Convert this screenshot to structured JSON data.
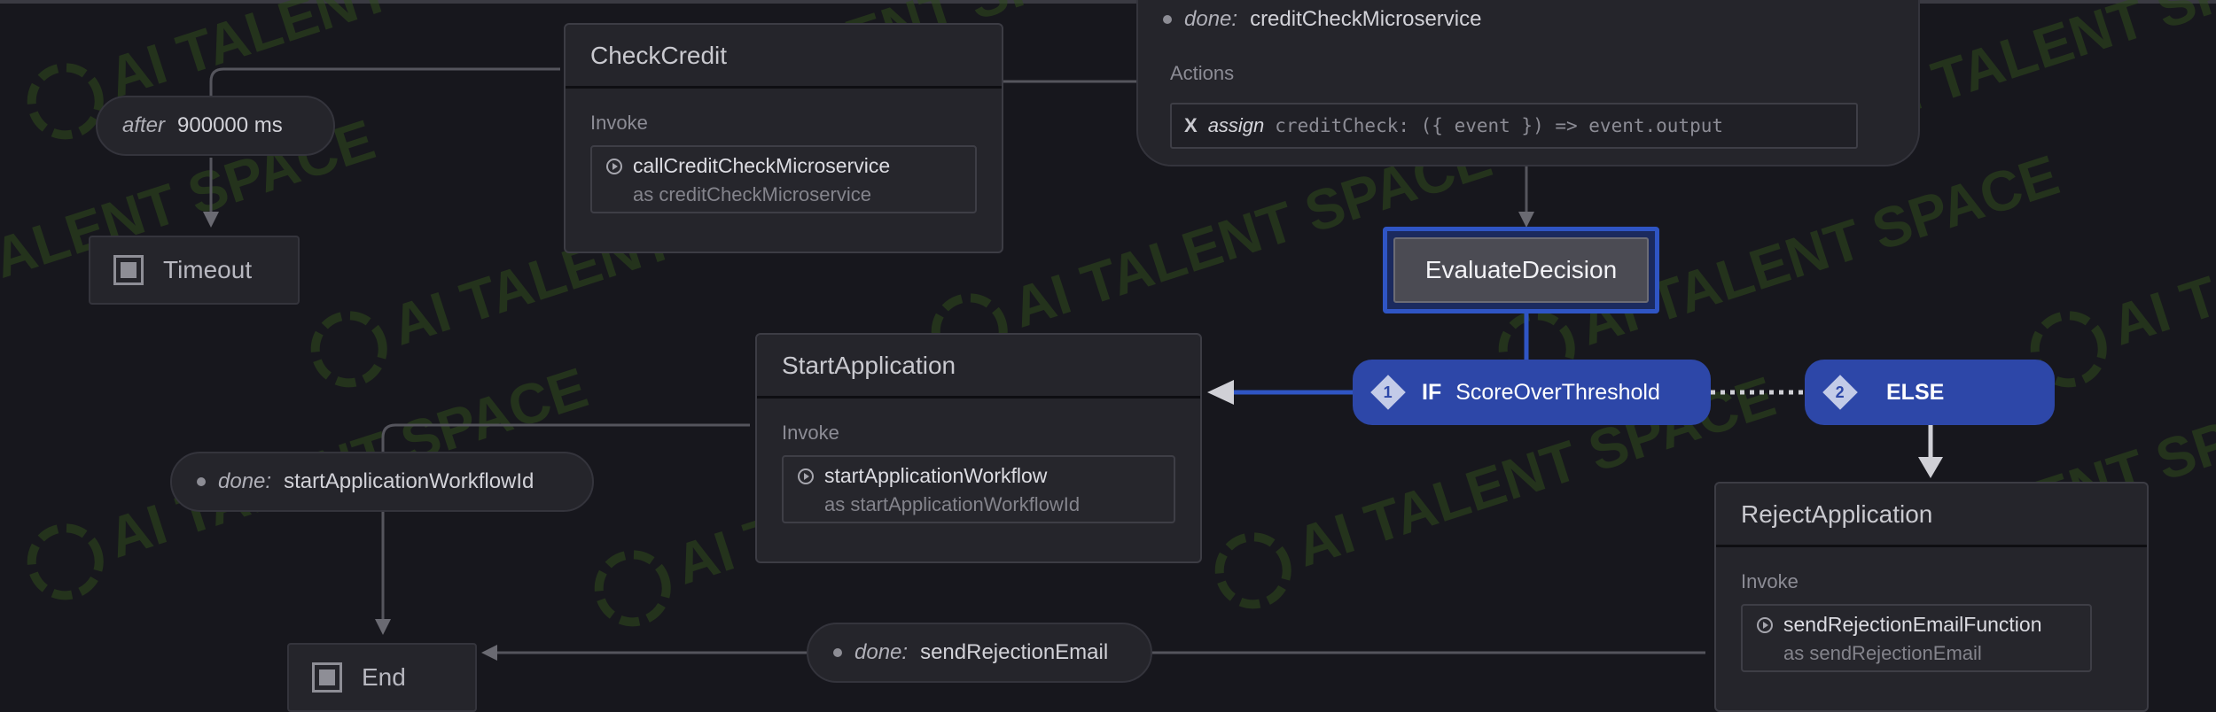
{
  "diagram": {
    "states": {
      "check_credit": {
        "title": "CheckCredit",
        "invoke_label": "Invoke",
        "service": "callCreditCheckMicroservice",
        "alias": "as creditCheckMicroservice"
      },
      "start_application": {
        "title": "StartApplication",
        "invoke_label": "Invoke",
        "service": "startApplicationWorkflow",
        "alias": "as startApplicationWorkflowId"
      },
      "reject_application": {
        "title": "RejectApplication",
        "invoke_label": "Invoke",
        "service": "sendRejectionEmailFunction",
        "alias": "as sendRejectionEmail"
      },
      "evaluate_decision": {
        "title": "EvaluateDecision"
      },
      "timeout": {
        "title": "Timeout"
      },
      "end": {
        "title": "End"
      }
    },
    "transitions": {
      "after_timer": {
        "keyword": "after",
        "value": "900000 ms"
      },
      "done_credit": {
        "keyword": "done:",
        "value": "creditCheckMicroservice",
        "actions_label": "Actions",
        "action_x": "X",
        "action_keyword": "assign",
        "action_code": "creditCheck:   ({ event }) => event.output"
      },
      "done_start": {
        "keyword": "done:",
        "value": "startApplicationWorkflowId"
      },
      "done_reject": {
        "keyword": "done:",
        "value": "sendRejectionEmail"
      }
    },
    "branches": {
      "if_branch": {
        "index": "1",
        "keyword": "IF",
        "guard": "ScoreOverThreshold"
      },
      "else_branch": {
        "index": "2",
        "keyword": "ELSE"
      }
    },
    "watermark": "AI TALENT SPACE",
    "colors": {
      "background": "#17171d",
      "node": "#25252b",
      "accent_blue": "#2d47a8",
      "selected_border": "#2f55c4",
      "edge": "#55555d",
      "watermark": "#2f4a1c"
    }
  }
}
